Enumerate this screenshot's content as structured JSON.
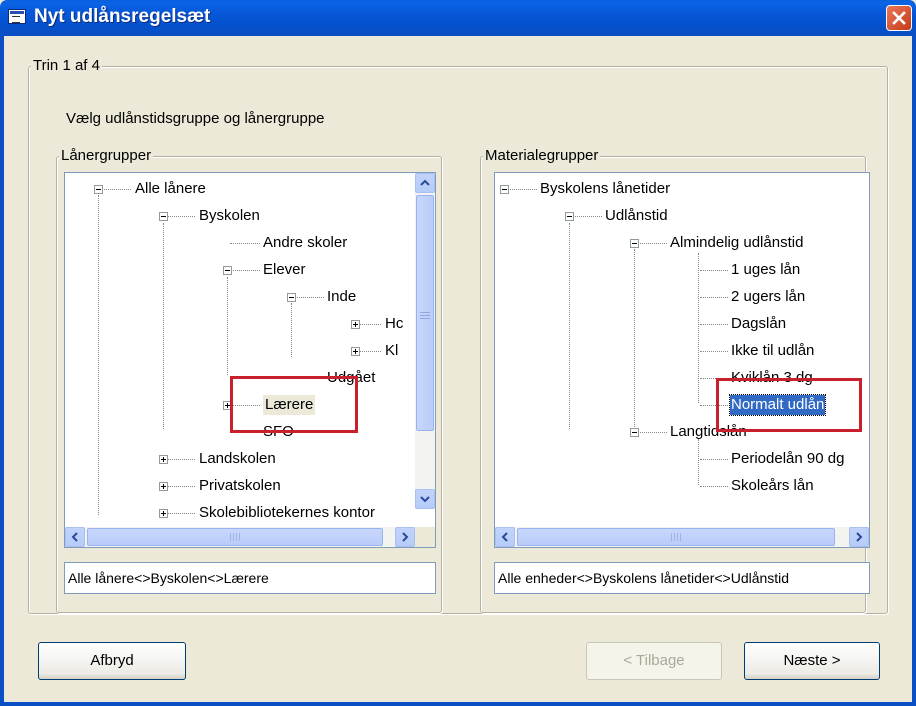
{
  "window": {
    "title": "Nyt udlånsregelsæt"
  },
  "step": {
    "legend": "Trin 1 af 4",
    "instruction": "Vælg udlånstidsgruppe og lånergruppe"
  },
  "left_panel": {
    "legend": "Lånergrupper",
    "tree": [
      {
        "label": "Alle lånere"
      },
      {
        "label": "Byskolen"
      },
      {
        "label": "Andre skoler"
      },
      {
        "label": "Elever"
      },
      {
        "label": "Inde"
      },
      {
        "label": "Hc"
      },
      {
        "label": "Kl"
      },
      {
        "label": "Udgået"
      },
      {
        "label": "Lærere"
      },
      {
        "label": "SFO"
      },
      {
        "label": "Landskolen"
      },
      {
        "label": "Privatskolen"
      },
      {
        "label": "Skolebibliotekernes kontor"
      }
    ],
    "path": "Alle lånere<>Byskolen<>Lærere"
  },
  "right_panel": {
    "legend": "Materialegrupper",
    "tree": [
      {
        "label": "Byskolens lånetider"
      },
      {
        "label": "Udlånstid"
      },
      {
        "label": "Almindelig udlånstid"
      },
      {
        "label": "1 uges lån"
      },
      {
        "label": "2 ugers lån"
      },
      {
        "label": "Dagslån"
      },
      {
        "label": "Ikke til udlån"
      },
      {
        "label": "Kviklån 3 dg"
      },
      {
        "label": "Normalt udlån"
      },
      {
        "label": "Langtidslån"
      },
      {
        "label": "Periodelån 90 dg"
      },
      {
        "label": "Skoleårs lån"
      }
    ],
    "path": "Alle enheder<>Byskolens lånetider<>Udlånstid"
  },
  "buttons": {
    "cancel": "Afbryd",
    "back": "< Tilbage",
    "next": "Næste >"
  },
  "colors": {
    "titlebar": "#0a5fdc",
    "selection": "#316ac5",
    "annotation": "#c8202c",
    "dialog": "#ece9d8"
  }
}
